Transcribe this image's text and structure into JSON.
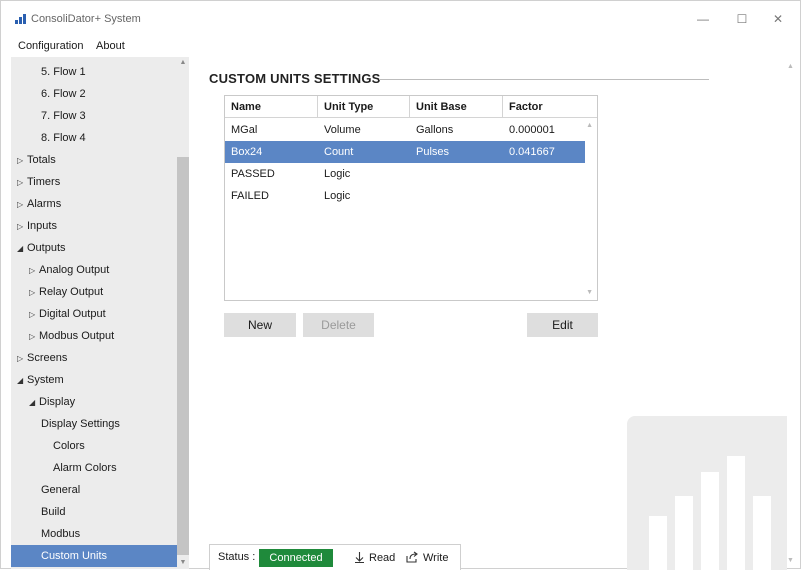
{
  "window": {
    "title": "ConsoliDator+ System",
    "controls": {
      "minimize": "—",
      "maximize": "☐",
      "close": "✕"
    }
  },
  "menu": {
    "items": [
      "Configuration",
      "About"
    ]
  },
  "sidebar": {
    "items": [
      {
        "label": "5. Flow 1",
        "arrow": ""
      },
      {
        "label": "6. Flow 2",
        "arrow": ""
      },
      {
        "label": "7. Flow 3",
        "arrow": ""
      },
      {
        "label": "8. Flow 4",
        "arrow": ""
      },
      {
        "label": "Totals",
        "arrow": "▷"
      },
      {
        "label": "Timers",
        "arrow": "▷"
      },
      {
        "label": "Alarms",
        "arrow": "▷"
      },
      {
        "label": "Inputs",
        "arrow": "▷"
      },
      {
        "label": "Outputs",
        "arrow": "◢"
      },
      {
        "label": "Analog Output",
        "arrow": "▷"
      },
      {
        "label": "Relay Output",
        "arrow": "▷"
      },
      {
        "label": "Digital Output",
        "arrow": "▷"
      },
      {
        "label": "Modbus Output",
        "arrow": "▷"
      },
      {
        "label": "Screens",
        "arrow": "▷"
      },
      {
        "label": "System",
        "arrow": "◢"
      },
      {
        "label": "Display",
        "arrow": "◢"
      },
      {
        "label": "Display Settings",
        "arrow": ""
      },
      {
        "label": "Colors",
        "arrow": ""
      },
      {
        "label": "Alarm Colors",
        "arrow": ""
      },
      {
        "label": "General",
        "arrow": ""
      },
      {
        "label": "Build",
        "arrow": ""
      },
      {
        "label": "Modbus",
        "arrow": ""
      },
      {
        "label": "Custom Units",
        "arrow": "",
        "selected": true
      }
    ]
  },
  "main": {
    "section_title": "CUSTOM UNITS SETTINGS",
    "columns": [
      "Name",
      "Unit Type",
      "Unit Base",
      "Factor"
    ],
    "rows": [
      [
        "MGal",
        "Volume",
        "Gallons",
        "0.000001"
      ],
      [
        "Box24",
        "Count",
        "Pulses",
        "0.041667"
      ],
      [
        "PASSED",
        "Logic",
        "",
        ""
      ],
      [
        "FAILED",
        "Logic",
        "",
        ""
      ]
    ],
    "selected_row": 1,
    "buttons": {
      "new": "New",
      "delete": "Delete",
      "edit": "Edit"
    }
  },
  "status": {
    "label": "Status :",
    "state": "Connected",
    "read": "Read",
    "write": "Write"
  },
  "colors": {
    "accent": "#5b86c5",
    "status_ok": "#1f8a3b",
    "sidebar_bg": "#ececec"
  }
}
